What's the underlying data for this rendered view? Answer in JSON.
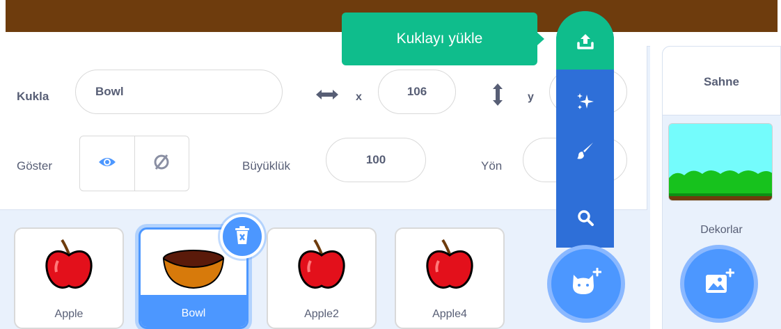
{
  "sprite_info": {
    "sprite_label": "Kukla",
    "sprite_name": "Bowl",
    "x_label": "x",
    "x_value": "106",
    "y_label": "y",
    "show_label": "Göster",
    "size_label": "Büyüklük",
    "size_value": "100",
    "direction_label": "Yön"
  },
  "sprites": [
    {
      "name": "Apple",
      "icon": "apple-sprite"
    },
    {
      "name": "Bowl",
      "icon": "bowl-sprite",
      "selected": true
    },
    {
      "name": "Apple2",
      "icon": "apple-sprite"
    },
    {
      "name": "Apple4",
      "icon": "apple-sprite"
    }
  ],
  "sprite_menu": {
    "tooltip": "Kuklayı yükle",
    "items": [
      "upload-icon",
      "surprise-icon",
      "paint-icon",
      "search-icon"
    ],
    "main_button_icon": "cat-plus-icon"
  },
  "stage": {
    "title": "Sahne",
    "backdrops_label": "Dekorlar",
    "backdrop_button_icon": "image-plus-icon"
  },
  "colors": {
    "stage_brown": "#6e3c0d",
    "accent_blue": "#4c97ff",
    "menu_blue": "#2e6fd8",
    "menu_green": "#0fbd8c",
    "text": "#575e75"
  }
}
